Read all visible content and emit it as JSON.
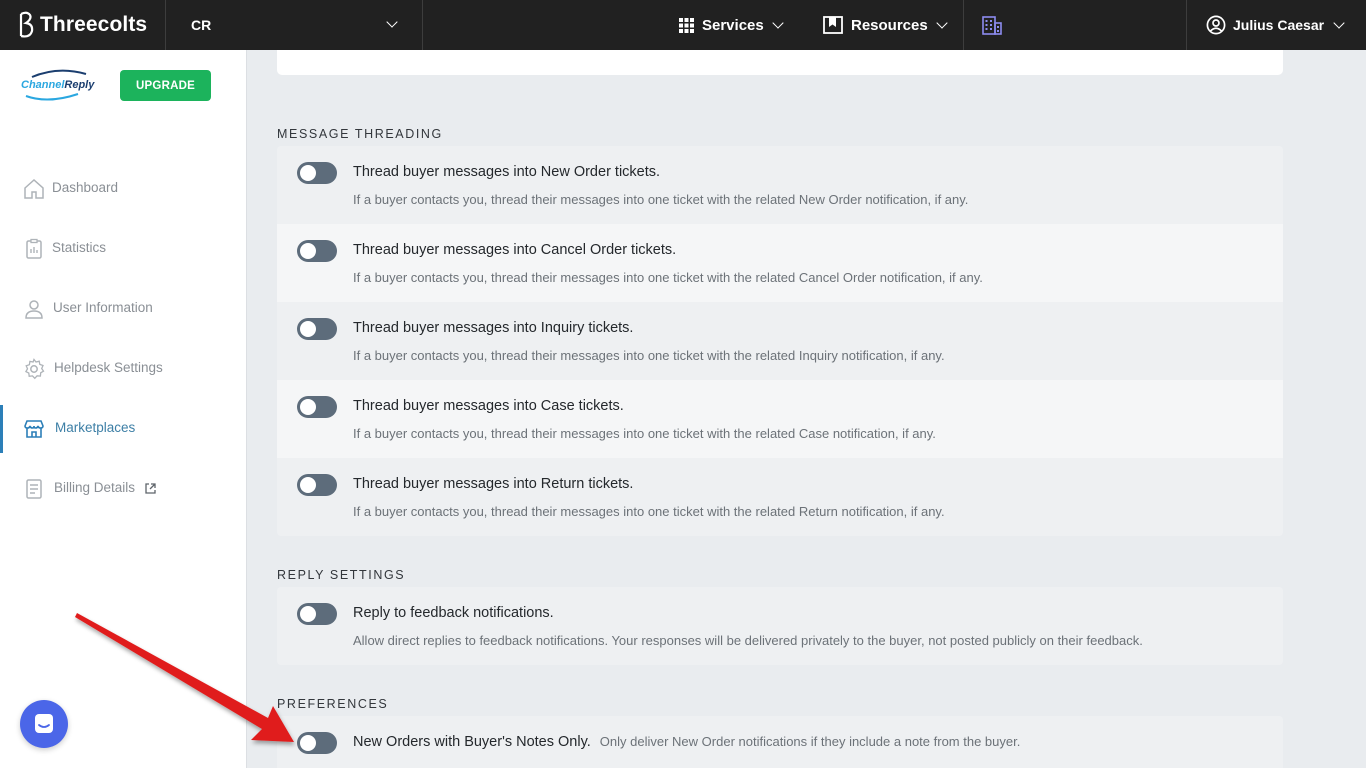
{
  "topbar": {
    "brand": "Threecolts",
    "account": "CR",
    "services": "Services",
    "resources": "Resources",
    "user": "Julius Caesar"
  },
  "sidebar": {
    "logo_text_1": "Channel",
    "logo_text_2": "Reply",
    "upgrade": "UPGRADE",
    "items": [
      {
        "label": "Dashboard",
        "icon": "home-icon"
      },
      {
        "label": "Statistics",
        "icon": "clipboard-icon"
      },
      {
        "label": "User Information",
        "icon": "user-icon"
      },
      {
        "label": "Helpdesk Settings",
        "icon": "gear-icon"
      },
      {
        "label": "Marketplaces",
        "icon": "store-icon",
        "active": true
      },
      {
        "label": "Billing Details",
        "icon": "invoice-icon"
      }
    ]
  },
  "message_threading": {
    "title": "MESSAGE THREADING",
    "rows": [
      {
        "title": "Thread buyer messages into New Order tickets.",
        "desc": "If a buyer contacts you, thread their messages into one ticket with the related New Order notification, if any.",
        "enabled": false
      },
      {
        "title": "Thread buyer messages into Cancel Order tickets.",
        "desc": "If a buyer contacts you, thread their messages into one ticket with the related Cancel Order notification, if any.",
        "enabled": false
      },
      {
        "title": "Thread buyer messages into Inquiry tickets.",
        "desc": "If a buyer contacts you, thread their messages into one ticket with the related Inquiry notification, if any.",
        "enabled": false
      },
      {
        "title": "Thread buyer messages into Case tickets.",
        "desc": "If a buyer contacts you, thread their messages into one ticket with the related Case notification, if any.",
        "enabled": false
      },
      {
        "title": "Thread buyer messages into Return tickets.",
        "desc": "If a buyer contacts you, thread their messages into one ticket with the related Return notification, if any.",
        "enabled": false
      }
    ]
  },
  "reply_settings": {
    "title": "REPLY SETTINGS",
    "rows": [
      {
        "title": "Reply to feedback notifications.",
        "desc": "Allow direct replies to feedback notifications. Your responses will be delivered privately to the buyer, not posted publicly on their feedback.",
        "enabled": false
      }
    ]
  },
  "preferences": {
    "title": "PREFERENCES",
    "rows": [
      {
        "title": "New Orders with Buyer's Notes Only.",
        "desc": "Only deliver New Order notifications if they include a note from the buyer.",
        "enabled": false
      }
    ]
  },
  "colors": {
    "topbar": "#212121",
    "upgrade": "#1cb35c",
    "toggle_off": "#5d6c7b",
    "active_nav": "#2c7fb8",
    "arrow": "#e01e1e",
    "chat": "#4b66e8"
  }
}
